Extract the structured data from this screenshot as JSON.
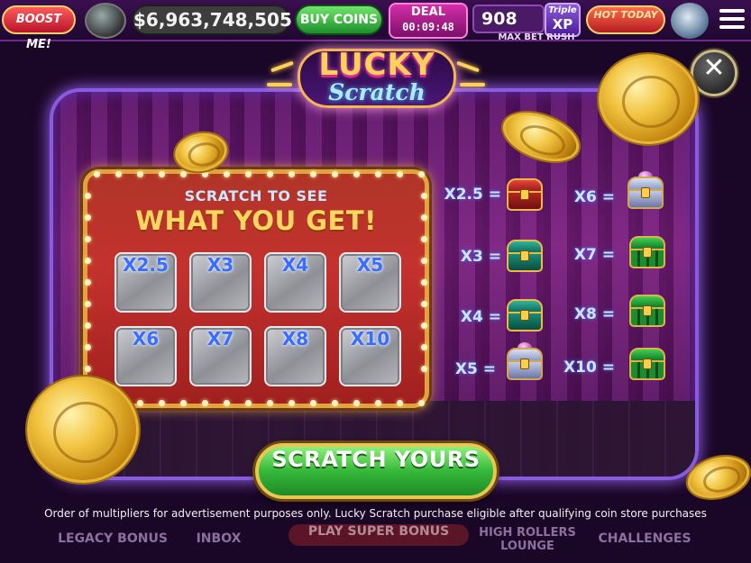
{
  "topbar": {
    "boost_label": "BOOST ME!",
    "balance": "$6,963,748,505",
    "buy_coins_label": "BUY COINS",
    "deal_label": "DEAL",
    "deal_timer": "00:09:48",
    "level": "908",
    "triple_line1": "Triple",
    "triple_line2": "XP",
    "max_bet_label": "MAX BET RUSH",
    "hot_today_label": "HOT TODAY"
  },
  "bottom_nav": {
    "legacy_bonus": "LEGACY BONUS",
    "inbox": "INBOX",
    "play_super_bonus": "PLAY SUPER BONUS",
    "high_rollers_lounge": "HIGH ROLLERS LOUNGE",
    "challenges": "CHALLENGES"
  },
  "modal": {
    "logo_top": "LUCKY",
    "logo_bottom": "Scratch",
    "close_glyph": "✕",
    "board_subtitle": "SCRATCH TO SEE",
    "board_title": "WHAT YOU GET!",
    "tiles": [
      "X2.5",
      "X3",
      "X4",
      "X5",
      "X6",
      "X7",
      "X8",
      "X10"
    ],
    "legend": [
      {
        "label": "X2.5 =",
        "chest": "red-chest"
      },
      {
        "label": "X3 =",
        "chest": "teal-chest"
      },
      {
        "label": "X4 =",
        "chest": "teal-chest"
      },
      {
        "label": "X5 =",
        "chest": "jewel-chest"
      },
      {
        "label": "X6 =",
        "chest": "jewel-chest"
      },
      {
        "label": "X7 =",
        "chest": "green-chest"
      },
      {
        "label": "X8 =",
        "chest": "green-chest"
      },
      {
        "label": "X10 =",
        "chest": "green-chest"
      }
    ],
    "cta_label": "SCRATCH YOURS",
    "disclaimer": "Order of multipliers for advertisement purposes only. Lucky Scratch purchase eligible after qualifying coin store purchases"
  },
  "colors": {
    "accent_gold": "#ffd660",
    "board_red": "#c4322e",
    "cta_green": "#35b83a",
    "frame_purple": "#8a5be0"
  }
}
